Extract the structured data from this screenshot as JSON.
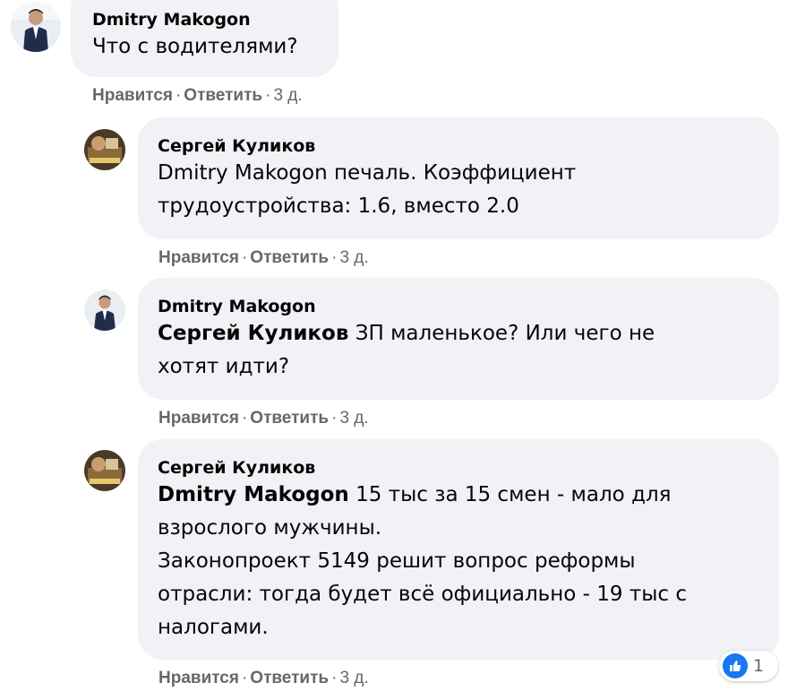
{
  "comments": [
    {
      "author": "Dmitry Makogon",
      "mention": "",
      "lines": [
        "Что с водителями?"
      ],
      "actions": {
        "like": "Нравится",
        "reply": "Ответить",
        "time": "3 д."
      }
    },
    {
      "author": "Сергей Куликов",
      "mention": "",
      "lines": [
        "Dmitry Makogon печаль. Коэффициент",
        "трудоустройства: 1.6, вместо 2.0"
      ],
      "actions": {
        "like": "Нравится",
        "reply": "Ответить",
        "time": "3 д."
      }
    },
    {
      "author": "Dmitry Makogon",
      "mention": "Сергей Куликов",
      "line1_rest": " ЗП маленькое? Или чего не",
      "lines": [
        "хотят идти?"
      ],
      "actions": {
        "like": "Нравится",
        "reply": "Ответить",
        "time": "3 д."
      }
    },
    {
      "author": "Сергей Куликов",
      "mention": "Dmitry Makogon",
      "line1_rest": " 15 тыс за 15 смен - мало для",
      "lines": [
        "взрослого мужчины.",
        "Законопроект 5149 решит вопрос реформы",
        "отрасли: тогда будет всё официально - 19 тыс с",
        "налогами."
      ],
      "actions": {
        "like": "Нравится",
        "reply": "Ответить",
        "time": "3 д."
      },
      "reactions": {
        "icon": "thumbs-up-icon",
        "count": "1"
      }
    }
  ],
  "colors": {
    "bubble": "#f0f2f5",
    "meta": "#65676b",
    "like_blue": "#1877f2"
  }
}
